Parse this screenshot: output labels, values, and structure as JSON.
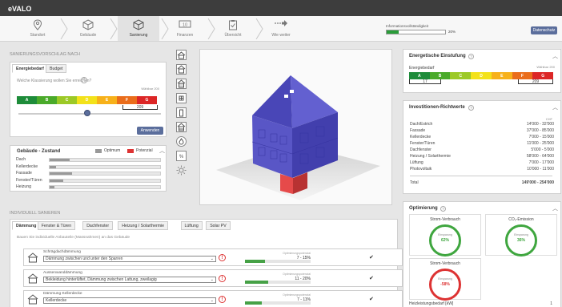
{
  "app": {
    "logo": "eVALO"
  },
  "steps": [
    {
      "label": "Standort",
      "icon": "location-pin-icon"
    },
    {
      "label": "Gebäude",
      "icon": "cube-icon"
    },
    {
      "label": "Sanierung",
      "icon": "cube-icon",
      "active": true
    },
    {
      "label": "Finanzen",
      "icon": "money-icon"
    },
    {
      "label": "Übersicht",
      "icon": "clipboard-check-icon"
    },
    {
      "label": "Wie weiter",
      "icon": "arrow-right-icon"
    }
  ],
  "completeness": {
    "label": "Informationsvollständigkeit",
    "value": 0.2,
    "value_text": "20%"
  },
  "header_btn": "Datenschutz",
  "sanierung": {
    "title": "SANIERUNGSVORSCHLAG NACH",
    "tabs": [
      "Energiebedarf",
      "Budget"
    ],
    "question": "Welche Klassierung wollen Sie erreichen?",
    "hint": "Wählbar 200",
    "scale": [
      "A",
      "B",
      "C",
      "D",
      "E",
      "F",
      "G"
    ],
    "marker_value": "209",
    "apply": "Anwenden"
  },
  "zustand": {
    "title": "Gebäude - Zustand",
    "legend": [
      "Optimum",
      "Potenzial"
    ],
    "rows": [
      {
        "label": "Dach",
        "value": 0.18
      },
      {
        "label": "Kellerdecke",
        "value": 0.06
      },
      {
        "label": "Fassade",
        "value": 0.2
      },
      {
        "label": "Fenster/Türen",
        "value": 0.12
      },
      {
        "label": "Heizung",
        "value": 0.04
      }
    ]
  },
  "individuell": {
    "title": "INDIVIDUELL SANIEREN",
    "tabs": [
      "Dämmung",
      "Fenster & Türen",
      "Dachfenster",
      "Heizung / Solarthermie",
      "Lüftung",
      "Solar PV"
    ],
    "instruction": "Bauen Sie individuelle Anbauteile (Massnahmen) an das Gebäude",
    "measures": [
      {
        "title": "Schrägdachdämmung",
        "select": "Dämmung zwischen und unter den Sparren",
        "caption": "Optimierungspotenzial",
        "range": "7 - 15%",
        "progress": 0.3
      },
      {
        "title": "Aussenwanddämmung",
        "select": "Bekleidung hinterlüftet, Dämmung zwischen Lattung, zweilagig",
        "caption": "Optimierungspotenzial",
        "range": "11 - 20%",
        "progress": 0.35
      },
      {
        "title": "Dämmung Kellerdecke",
        "select": "Kellerdecke",
        "caption": "Optimierungspotenzial",
        "range": "7 - 11%",
        "progress": 0.25
      }
    ]
  },
  "energy": {
    "title": "Energetische Einstufung",
    "sublabel": "Energiebedarf",
    "hint": "Wählbar 200",
    "scale": [
      "A",
      "B",
      "C",
      "D",
      "E",
      "F",
      "G"
    ],
    "left_value": "17",
    "right_value": "209"
  },
  "investitionen": {
    "title": "Investitionen-Richtwerte",
    "unit": "CHF",
    "rows": [
      {
        "label": "Dach/Estrich",
        "value": "14'000 - 32'000"
      },
      {
        "label": "Fassade",
        "value": "37'000 - 85'000"
      },
      {
        "label": "Kellerdecke",
        "value": "7'000 - 15'000"
      },
      {
        "label": "Fenster/Türen",
        "value": "11'000 - 25'000"
      },
      {
        "label": "Dachfenster",
        "value": "5'000 - 5'000"
      },
      {
        "label": "Heizung / Solarthermie",
        "value": "58'000 - 64'000"
      },
      {
        "label": "Lüftung",
        "value": "7'000 - 17'000"
      },
      {
        "label": "Photovoltaik",
        "value": "10'000 - 11'000"
      }
    ],
    "total_label": "Total",
    "total_value": "149'000 - 254'000"
  },
  "optimierung": {
    "title": "Optimierung",
    "gauges": [
      {
        "label": "Strom-Verbrauch",
        "caption": "Einsparung",
        "value": "62%"
      },
      {
        "label": "CO₂-Emission",
        "caption": "Einsparung",
        "value": "36%"
      },
      {
        "label": "Strom-Verbrauch",
        "caption": "Einsparung",
        "value": "-58%"
      }
    ],
    "footer_label": "Heizleistungsbedarf [kW]",
    "footer_value": "1"
  },
  "colors": {
    "scale": [
      "#1e8c3a",
      "#4aaa2a",
      "#9cc926",
      "#f3e21a",
      "#f7b11a",
      "#ea6d1b",
      "#dc2626"
    ],
    "accent": "#5b6e9c",
    "house": "#5c58c6"
  }
}
